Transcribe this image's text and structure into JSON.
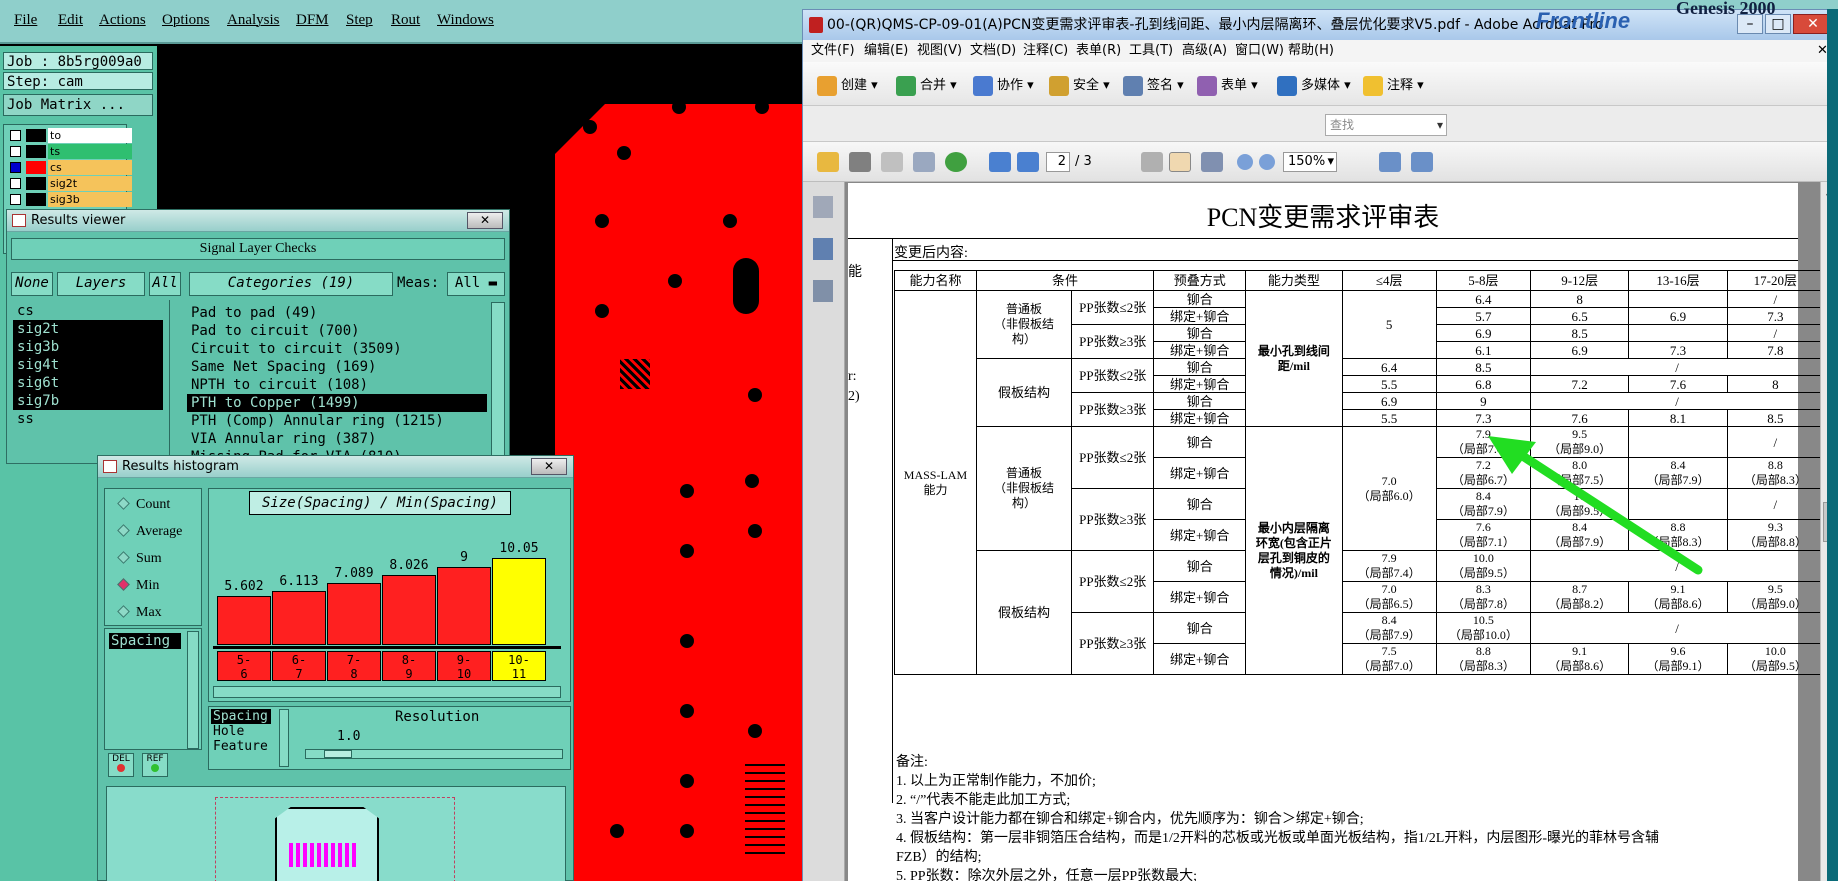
{
  "genesis": {
    "menu": [
      "File",
      "Edit",
      "Actions",
      "Options",
      "Analysis",
      "DFM",
      "Step",
      "Rout",
      "Windows"
    ],
    "job": "Job : 8b5rg009a0",
    "step": "Step: cam",
    "job_matrix": "Job Matrix ...",
    "layers": [
      {
        "name": "to",
        "color": "#000000",
        "bg": "#ffffff"
      },
      {
        "name": "ts",
        "color": "#000000",
        "bg": "#2fbf70"
      },
      {
        "name": "cs",
        "color": "#ff0000",
        "bg": "#f5c35b"
      },
      {
        "name": "sig2t",
        "color": "#000000",
        "bg": "#f5c35b"
      },
      {
        "name": "sig3b",
        "color": "#000000",
        "bg": "#f5c35b"
      }
    ],
    "brand_top": "Genesis 2000",
    "brand_logo": "Frontline"
  },
  "results_viewer": {
    "title": "Results viewer",
    "header": "Signal Layer Checks",
    "none_btn": "None",
    "layers_btn": "Layers",
    "all_btn": "All",
    "categories_btn": "Categories (19)",
    "meas_label": "Meas:",
    "meas_value": "All",
    "layer_list": [
      "cs",
      "sig2t",
      "sig3b",
      "sig4t",
      "sig6t",
      "sig7b",
      "ss"
    ],
    "categories": [
      "Pad to pad (49)",
      "Pad to circuit (700)",
      "Circuit to circuit (3509)",
      "Same Net Spacing (169)",
      "NPTH to circuit (108)",
      "PTH to Copper (1499)",
      "PTH (Comp) Annular ring (1215)",
      "VIA Annular ring (387)",
      "Missing Pad for VIA (810)"
    ]
  },
  "histogram": {
    "title": "Results histogram",
    "radios": [
      "Count",
      "Average",
      "Sum",
      "Min",
      "Max"
    ],
    "selected_radio": "Min",
    "chart_title": "Size(Spacing) / Min(Spacing)",
    "meas_item": "Spacing",
    "values": [
      "5.602",
      "6.113",
      "7.089",
      "8.026",
      "9",
      "10.05"
    ],
    "bins": [
      "5-\n6",
      "6-\n7",
      "7-\n8",
      "8-\n9",
      "9-\n10",
      "10-\n11"
    ],
    "lower_list": [
      "Spacing",
      "Hole",
      "Feature"
    ],
    "resolution_label": "Resolution",
    "resolution_value": "1.0",
    "del_btn": "DEL",
    "ref_btn": "REF"
  },
  "acrobat": {
    "title": "00-(QR)QMS-CP-09-01(A)PCN变更需求评审表-孔到线间距、最小内层隔离环、叠层优化要求V5.pdf - Adobe Acrobat Pro",
    "menu": [
      "文件(F)",
      "编辑(E)",
      "视图(V)",
      "文档(D)",
      "注释(C)",
      "表单(R)",
      "工具(T)",
      "高级(A)",
      "窗口(W)",
      "帮助(H)"
    ],
    "tools": [
      "创建",
      "合并",
      "协作",
      "安全",
      "签名",
      "表单",
      "多媒体",
      "注释"
    ],
    "search_placeholder": "查找",
    "page_current": "2",
    "page_total": "/ 3",
    "zoom": "150%"
  },
  "pcn": {
    "title": "PCN变更需求评审表",
    "after_label": "变更后内容:",
    "left_frag1": "能",
    "left_frag2": "r:",
    "left_frag3": "2)",
    "headers": [
      "能力名称",
      "条件",
      "预叠方式",
      "能力类型",
      "≤4层",
      "5-8层",
      "9-12层",
      "13-16层",
      "17-20层"
    ],
    "mass_lam": "MASS-LAM\n能力",
    "normal_board": "普通板\n（非假板结\n构）",
    "fake_board": "假板结构",
    "pp_le2": "PP张数≤2张",
    "pp_ge3": "PP张数≥3张",
    "rivet": "铆合",
    "bond_rivet": "绑定+铆合",
    "type1": "最小孔到线间\n距/mil",
    "type2": "最小内层隔离\n环宽(包含正片\n层孔到铜皮的\n情况)/mil",
    "slash": "/",
    "sec1": {
      "le4_normal": "5",
      "rows": [
        [
          "",
          "6.4",
          "8",
          "",
          "/"
        ],
        [
          "",
          "5.7",
          "6.5",
          "6.9",
          "7.3"
        ],
        [
          "",
          "6.9",
          "8.5",
          "",
          "/"
        ],
        [
          "",
          "6.1",
          "6.9",
          "7.3",
          "7.8"
        ],
        [
          "6.4",
          "8.5",
          "",
          "",
          "/"
        ],
        [
          "5.5",
          "6.8",
          "7.2",
          "7.6",
          "8"
        ],
        [
          "6.9",
          "9",
          "",
          "",
          "/"
        ],
        [
          "5.5",
          "7.3",
          "7.6",
          "8.1",
          "8.5"
        ]
      ]
    },
    "sec2": {
      "le4_normal": "7.0\n（局部6.0）",
      "rows": [
        [
          "",
          "7.9\n（局部7.4）",
          "9.5\n（局部9.0）",
          "",
          "/"
        ],
        [
          "",
          "7.2\n（局部6.7）",
          "8.0\n（局部7.5）",
          "8.4\n（局部7.9）",
          "8.8\n（局部8.3）"
        ],
        [
          "",
          "8.4\n（局部7.9）",
          "10\n（局部9.5）",
          "",
          "/"
        ],
        [
          "",
          "7.6\n（局部7.1）",
          "8.4\n（局部7.9）",
          "8.8\n（局部8.3）",
          "9.3\n（局部8.8）"
        ],
        [
          "7.9\n（局部7.4）",
          "10.0\n（局部9.5）",
          "",
          "",
          "/"
        ],
        [
          "7.0\n（局部6.5）",
          "8.3\n（局部7.8）",
          "8.7\n（局部8.2）",
          "9.1\n（局部8.6）",
          "9.5\n（局部9.0）"
        ],
        [
          "8.4\n（局部7.9）",
          "10.5\n（局部10.0）",
          "",
          "",
          "/"
        ],
        [
          "7.5\n（局部7.0）",
          "8.8\n（局部8.3）",
          "9.1\n（局部8.6）",
          "9.6\n（局部9.1）",
          "10.0\n（局部9.5）"
        ]
      ]
    },
    "notes": [
      "备注:",
      "1. 以上为正常制作能力，不加价;",
      "2. “/”代表不能走此加工方式;",
      "3. 当客户设计能力都在铆合和绑定+铆合内，优先顺序为：铆合＞绑定+铆合;",
      "4. 假板结构：第一层非铜箔压合结构，而是1/2开料的芯板或光板或单面光板结构，指1/2L开料，内层图形-曝光的菲林号含辅",
      "FZB）的结构;",
      "5. PP张数：除次外层之外，任意一层PP张数最大;"
    ]
  },
  "colors": {
    "board": "#ff0000",
    "genesis_bg": "#59c3a6",
    "annotation_arrow": "#22dd22",
    "highlight_bar": "#ffff00"
  }
}
